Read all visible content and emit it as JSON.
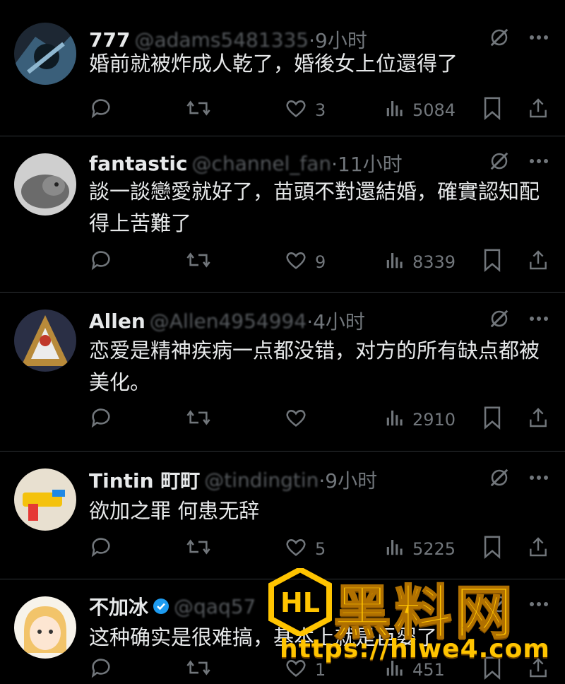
{
  "tweets": [
    {
      "name": "777",
      "handle": "@adams5481335",
      "time": "·9小时",
      "text": "婚前就被炸成人乾了，婚後女上位還得了",
      "likes": "3",
      "views": "5084"
    },
    {
      "name": "fantastic",
      "handle": "@channel_fan",
      "time": "·11小时",
      "text": "談一談戀愛就好了，苗頭不對還結婚，確實認知配得上苦難了",
      "likes": "9",
      "views": "8339"
    },
    {
      "name": "Allen",
      "handle": "@Allen4954994",
      "time": "·4小时",
      "text": "恋爱是精神疾病一点都没错，对方的所有缺点都被美化。",
      "likes": "",
      "views": "2910"
    },
    {
      "name": "Tintin 町町",
      "handle": "@tindingtin",
      "time": "·9小时",
      "text": "欲加之罪 何患无辞",
      "likes": "5",
      "views": "5225"
    },
    {
      "name": "不加冰",
      "handle": "@qaq57",
      "time": "",
      "text": "这种确实是很难搞，基本上就是巨婴了",
      "likes": "1",
      "views": "451"
    }
  ],
  "watermark": {
    "title": "黑料网",
    "url": "https://hlwe4.com",
    "logo": "HL"
  },
  "icons": {
    "reply": "reply-icon",
    "retweet": "retweet-icon",
    "like": "like-icon",
    "views": "views-icon",
    "bookmark": "bookmark-icon",
    "share": "share-icon",
    "grok": "grok-icon",
    "more": "more-icon"
  }
}
